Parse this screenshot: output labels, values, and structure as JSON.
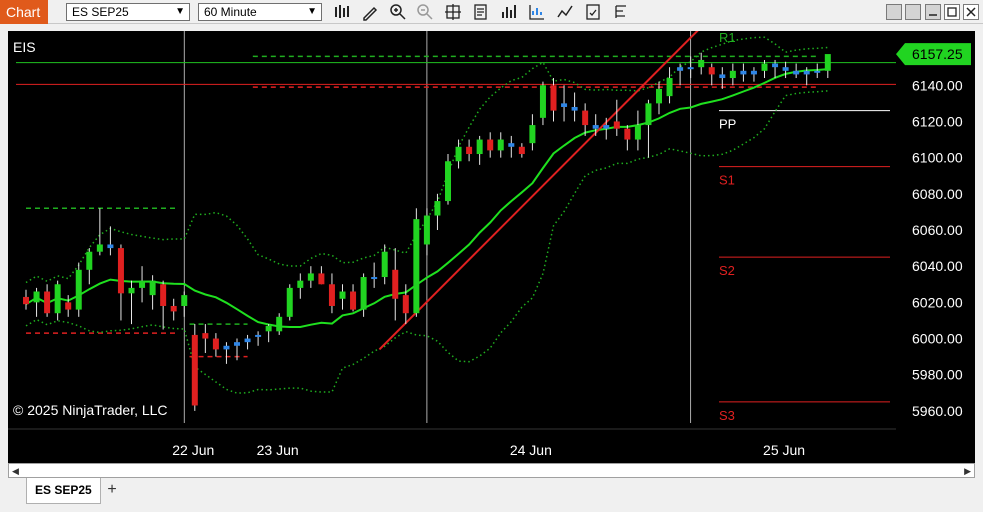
{
  "toolbar": {
    "chart_label": "Chart",
    "instrument": "ES SEP25",
    "interval": "60 Minute"
  },
  "chart": {
    "instrument_label": "EIS",
    "copyright": "© 2025 NinjaTrader, LLC",
    "current_price_label": "6157.25",
    "current_price": 6157.25,
    "price_min": 5950,
    "price_max": 6170,
    "y_ticks": [
      {
        "v": 6140,
        "label": "6140.00"
      },
      {
        "v": 6120,
        "label": "6120.00"
      },
      {
        "v": 6100,
        "label": "6100.00"
      },
      {
        "v": 6080,
        "label": "6080.00"
      },
      {
        "v": 6060,
        "label": "6060.00"
      },
      {
        "v": 6040,
        "label": "6040.00"
      },
      {
        "v": 6020,
        "label": "6020.00"
      },
      {
        "v": 6000,
        "label": "6000.00"
      },
      {
        "v": 5980,
        "label": "5980.00"
      },
      {
        "v": 5960,
        "label": "5960.00"
      }
    ],
    "x_labels": [
      {
        "i": 15,
        "label": "22 Jun"
      },
      {
        "i": 23,
        "label": "23 Jun"
      },
      {
        "i": 47,
        "label": "24 Jun"
      },
      {
        "i": 71,
        "label": "25 Jun"
      }
    ],
    "session_dividers": [
      15,
      38,
      63
    ],
    "pivots": [
      {
        "name": "R1",
        "v": 6175
      },
      {
        "name": "PP",
        "v": 6126
      },
      {
        "name": "S1",
        "v": 6095
      },
      {
        "name": "S2",
        "v": 6045
      },
      {
        "name": "S3",
        "v": 5965
      }
    ],
    "h_lines": [
      {
        "v": 6152.5,
        "color": "#21c321",
        "style": "solid"
      },
      {
        "v": 6140.5,
        "color": "#e02020",
        "style": "solid"
      }
    ],
    "dashed_levels": [
      {
        "v": 6072,
        "from": 0,
        "to": 14.5,
        "color": "#1fae1f"
      },
      {
        "v": 6003,
        "from": 0,
        "to": 14.5,
        "color": "#e02020"
      },
      {
        "v": 6008,
        "from": 15.5,
        "to": 21,
        "color": "#1fae1f"
      },
      {
        "v": 5990,
        "from": 15.5,
        "to": 21,
        "color": "#e02020"
      },
      {
        "v": 6156,
        "from": 21.5,
        "to": 75,
        "color": "#1fae1f"
      },
      {
        "v": 6139,
        "from": 21.5,
        "to": 75,
        "color": "#e02020"
      }
    ],
    "trendline": {
      "from": [
        33.5,
        5994
      ],
      "to": [
        65,
        6178
      ],
      "color": "#e02020"
    },
    "colors": {
      "up": "#21d421",
      "down": "#e02020",
      "doji": "#2f86e6",
      "ma": "#1fe01f",
      "band": "#1fae1f",
      "price_box": "#21d421"
    }
  },
  "chart_data": {
    "type": "candlestick",
    "instrument": "EIS",
    "interval": "60 Minute",
    "x_labels": [
      "22 Jun",
      "23 Jun",
      "24 Jun",
      "25 Jun"
    ],
    "ylim": [
      5950,
      6170
    ],
    "candles": [
      [
        6023,
        6027,
        6016,
        6019
      ],
      [
        6020,
        6028,
        6012,
        6026
      ],
      [
        6026,
        6030,
        6012,
        6014
      ],
      [
        6014,
        6032,
        6010,
        6030
      ],
      [
        6020,
        6024,
        6012,
        6016
      ],
      [
        6016,
        6042,
        6012,
        6038
      ],
      [
        6038,
        6050,
        6030,
        6048
      ],
      [
        6048,
        6072,
        6046,
        6052
      ],
      [
        6052,
        6062,
        6046,
        6050
      ],
      [
        6050,
        6052,
        6010,
        6025
      ],
      [
        6025,
        6032,
        6008,
        6028
      ],
      [
        6028,
        6040,
        6020,
        6032
      ],
      [
        6024,
        6035,
        6016,
        6032
      ],
      [
        6030,
        6032,
        6005,
        6018
      ],
      [
        6018,
        6022,
        6010,
        6015
      ],
      [
        6018,
        6026,
        6012,
        6024
      ],
      [
        6002,
        6008,
        5960,
        5963
      ],
      [
        6003,
        6008,
        5992,
        6000
      ],
      [
        6000,
        6003,
        5990,
        5994
      ],
      [
        5994,
        5998,
        5986,
        5996
      ],
      [
        5996,
        6000,
        5988,
        5998
      ],
      [
        5998,
        6002,
        5994,
        6000
      ],
      [
        6001,
        6004,
        5996,
        6002
      ],
      [
        6004,
        6008,
        5998,
        6007
      ],
      [
        6004,
        6014,
        6002,
        6012
      ],
      [
        6012,
        6030,
        6010,
        6028
      ],
      [
        6028,
        6036,
        6022,
        6032
      ],
      [
        6032,
        6040,
        6028,
        6036
      ],
      [
        6036,
        6040,
        6030,
        6030
      ],
      [
        6030,
        6036,
        6014,
        6018
      ],
      [
        6022,
        6030,
        6016,
        6026
      ],
      [
        6026,
        6030,
        6015,
        6016
      ],
      [
        6016,
        6036,
        6012,
        6034
      ],
      [
        6034,
        6042,
        6028,
        6034
      ],
      [
        6034,
        6052,
        6030,
        6048
      ],
      [
        6038,
        6050,
        6010,
        6022
      ],
      [
        6024,
        6030,
        6008,
        6014
      ],
      [
        6014,
        6072,
        6012,
        6066
      ],
      [
        6052,
        6072,
        6046,
        6068
      ],
      [
        6068,
        6080,
        6060,
        6076
      ],
      [
        6076,
        6102,
        6074,
        6098
      ],
      [
        6098,
        6110,
        6094,
        6106
      ],
      [
        6106,
        6110,
        6098,
        6102
      ],
      [
        6102,
        6112,
        6096,
        6110
      ],
      [
        6110,
        6114,
        6100,
        6104
      ],
      [
        6104,
        6114,
        6100,
        6110
      ],
      [
        6108,
        6112,
        6100,
        6106
      ],
      [
        6106,
        6108,
        6100,
        6102
      ],
      [
        6108,
        6124,
        6104,
        6118
      ],
      [
        6122,
        6142,
        6118,
        6140
      ],
      [
        6140,
        6144,
        6120,
        6126
      ],
      [
        6130,
        6140,
        6120,
        6128
      ],
      [
        6128,
        6136,
        6120,
        6126
      ],
      [
        6126,
        6130,
        6112,
        6118
      ],
      [
        6118,
        6124,
        6112,
        6116
      ],
      [
        6116,
        6122,
        6110,
        6118
      ],
      [
        6120,
        6132,
        6112,
        6116
      ],
      [
        6116,
        6118,
        6104,
        6110
      ],
      [
        6110,
        6126,
        6104,
        6118
      ],
      [
        6118,
        6132,
        6100,
        6130
      ],
      [
        6130,
        6142,
        6124,
        6138
      ],
      [
        6134,
        6150,
        6130,
        6144
      ],
      [
        6148,
        6152,
        6140,
        6150
      ],
      [
        6150,
        6156,
        6144,
        6150
      ],
      [
        6150,
        6158,
        6146,
        6154
      ],
      [
        6150,
        6152,
        6140,
        6146
      ],
      [
        6146,
        6150,
        6138,
        6144
      ],
      [
        6144,
        6152,
        6140,
        6148
      ],
      [
        6148,
        6152,
        6142,
        6146
      ],
      [
        6146,
        6150,
        6142,
        6148
      ],
      [
        6148,
        6154,
        6144,
        6152
      ],
      [
        6152,
        6154,
        6144,
        6150
      ],
      [
        6150,
        6153,
        6144,
        6148
      ],
      [
        6148,
        6152,
        6144,
        6146
      ],
      [
        6146,
        6150,
        6140,
        6148
      ],
      [
        6148,
        6152,
        6144,
        6148
      ],
      [
        6148,
        6156,
        6144,
        6157.25
      ]
    ]
  }
}
